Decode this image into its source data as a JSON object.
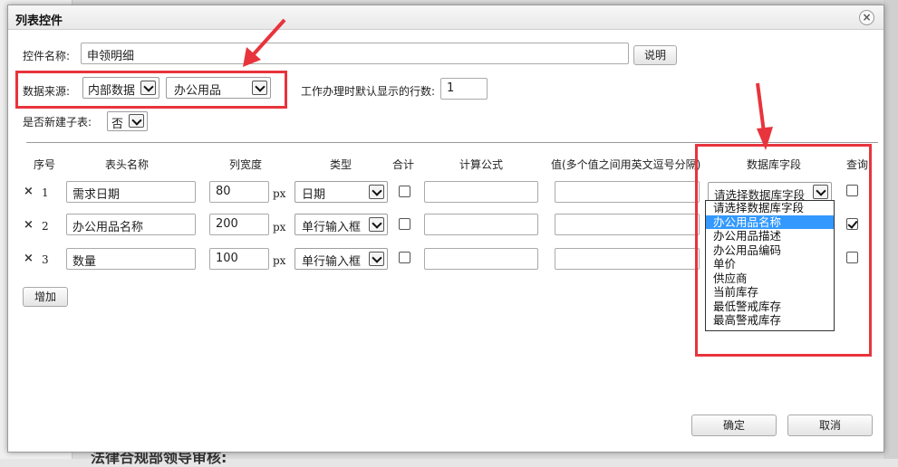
{
  "background": {
    "bottom_text": "法律合规部领导审核:"
  },
  "dialog": {
    "title": "列表控件",
    "close_icon": "close-icon"
  },
  "form": {
    "control_name_label": "控件名称:",
    "control_name_value": "申领明细",
    "explain_button": "说明",
    "data_source_label": "数据来源:",
    "data_source_value": "内部数据",
    "category_value": "办公用品",
    "rows_label": "工作办理时默认显示的行数:",
    "rows_value": "1",
    "subtable_label": "是否新建子表:",
    "subtable_value": "否"
  },
  "table": {
    "headers": {
      "index": "序号",
      "header_name": "表头名称",
      "width": "列宽度",
      "type": "类型",
      "sum": "合计",
      "formula": "计算公式",
      "values": "值(多个值之间用英文逗号分隔)",
      "db_field": "数据库字段",
      "query": "查询"
    },
    "rows": [
      {
        "delete": "×",
        "index": "1",
        "name": "需求日期",
        "width": "80",
        "unit": "px",
        "type": "日期",
        "sum": false,
        "db_field": "请选择数据库字段",
        "query": false
      },
      {
        "delete": "×",
        "index": "2",
        "name": "办公用品名称",
        "width": "200",
        "unit": "px",
        "type": "单行输入框",
        "sum": false,
        "query": true
      },
      {
        "delete": "×",
        "index": "3",
        "name": "数量",
        "width": "100",
        "unit": "px",
        "type": "单行输入框",
        "sum": false,
        "query": false
      }
    ],
    "add_button": "增加"
  },
  "db_field_dropdown": {
    "options": [
      "请选择数据库字段",
      "办公用品名称",
      "办公用品描述",
      "办公用品编码",
      "单价",
      "供应商",
      "当前库存",
      "最低警戒库存",
      "最高警戒库存"
    ],
    "selected_index": 1
  },
  "footer": {
    "ok_button": "确定",
    "cancel_button": "取消"
  },
  "annotation_color": "#e8343c"
}
